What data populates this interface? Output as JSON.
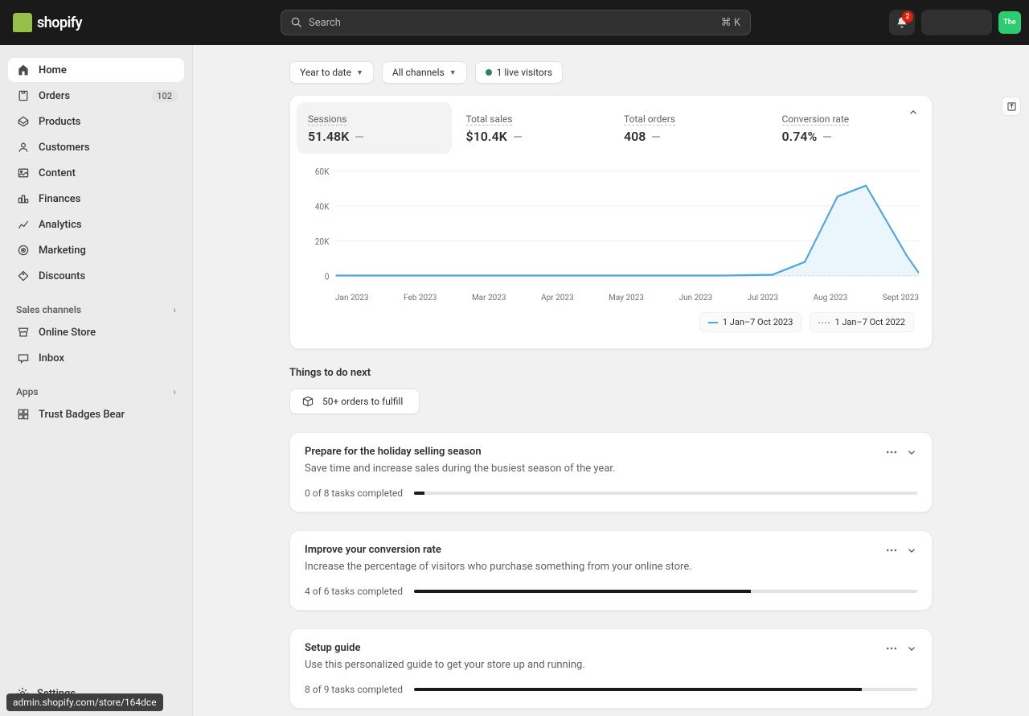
{
  "topbar": {
    "logo_text": "shopify",
    "search_placeholder": "Search",
    "keyboard_hint": "⌘ K",
    "notification_count": "2",
    "avatar_label": "The"
  },
  "sidebar": {
    "items": [
      {
        "label": "Home",
        "icon": "home",
        "active": true
      },
      {
        "label": "Orders",
        "icon": "orders",
        "badge": "102"
      },
      {
        "label": "Products",
        "icon": "products"
      },
      {
        "label": "Customers",
        "icon": "customers"
      },
      {
        "label": "Content",
        "icon": "content"
      },
      {
        "label": "Finances",
        "icon": "finances"
      },
      {
        "label": "Analytics",
        "icon": "analytics"
      },
      {
        "label": "Marketing",
        "icon": "marketing"
      },
      {
        "label": "Discounts",
        "icon": "discounts"
      }
    ],
    "section_sales_label": "Sales channels",
    "sales_items": [
      {
        "label": "Online Store"
      },
      {
        "label": "Inbox"
      }
    ],
    "section_apps_label": "Apps",
    "apps_items": [
      {
        "label": "Trust Badges Bear"
      }
    ],
    "settings_label": "Settings"
  },
  "toolbar": {
    "date_range_label": "Year to date",
    "channels_label": "All channels",
    "live_visitors_label": "1 live visitors"
  },
  "metrics": [
    {
      "label": "Sessions",
      "value": "51.48K",
      "active": true
    },
    {
      "label": "Total sales",
      "value": "$10.4K"
    },
    {
      "label": "Total orders",
      "value": "408"
    },
    {
      "label": "Conversion rate",
      "value": "0.74%"
    }
  ],
  "chart_data": {
    "type": "line",
    "categories": [
      "Jan 2023",
      "Feb 2023",
      "Mar 2023",
      "Apr 2023",
      "May 2023",
      "Jun 2023",
      "Jul 2023",
      "Aug 2023",
      "Sept 2023"
    ],
    "ylabels": [
      "60K",
      "40K",
      "20K",
      "0"
    ],
    "ylim": [
      0,
      60000
    ],
    "series": [
      {
        "name": "1 Jan–7 Oct 2023",
        "color": "#4ba7e4",
        "values": [
          50,
          50,
          50,
          50,
          50,
          50,
          100,
          8000,
          45000,
          12000
        ]
      },
      {
        "name": "1 Jan–7 Oct 2022",
        "color": "#b5b5b5",
        "dashed": true,
        "values": [
          0,
          0,
          0,
          0,
          0,
          0,
          0,
          0,
          0,
          0
        ]
      }
    ],
    "legend": [
      {
        "label": "1 Jan–7 Oct 2023"
      },
      {
        "label": "1 Jan–7 Oct 2022"
      }
    ]
  },
  "section_next_label": "Things to do next",
  "fulfill_label": "50+ orders to fulfill",
  "guides": [
    {
      "title": "Prepare for the holiday selling season",
      "subtitle": "Save time and increase sales during the busiest season of the year.",
      "progress_label": "0 of 8 tasks completed",
      "progress_pct": 2
    },
    {
      "title": "Improve your conversion rate",
      "subtitle": "Increase the percentage of visitors who purchase something from your online store.",
      "progress_label": "4 of 6 tasks completed",
      "progress_pct": 67
    },
    {
      "title": "Setup guide",
      "subtitle": "Use this personalized guide to get your store up and running.",
      "progress_label": "8 of 9 tasks completed",
      "progress_pct": 89
    }
  ],
  "status_url": "admin.shopify.com/store/164dce"
}
